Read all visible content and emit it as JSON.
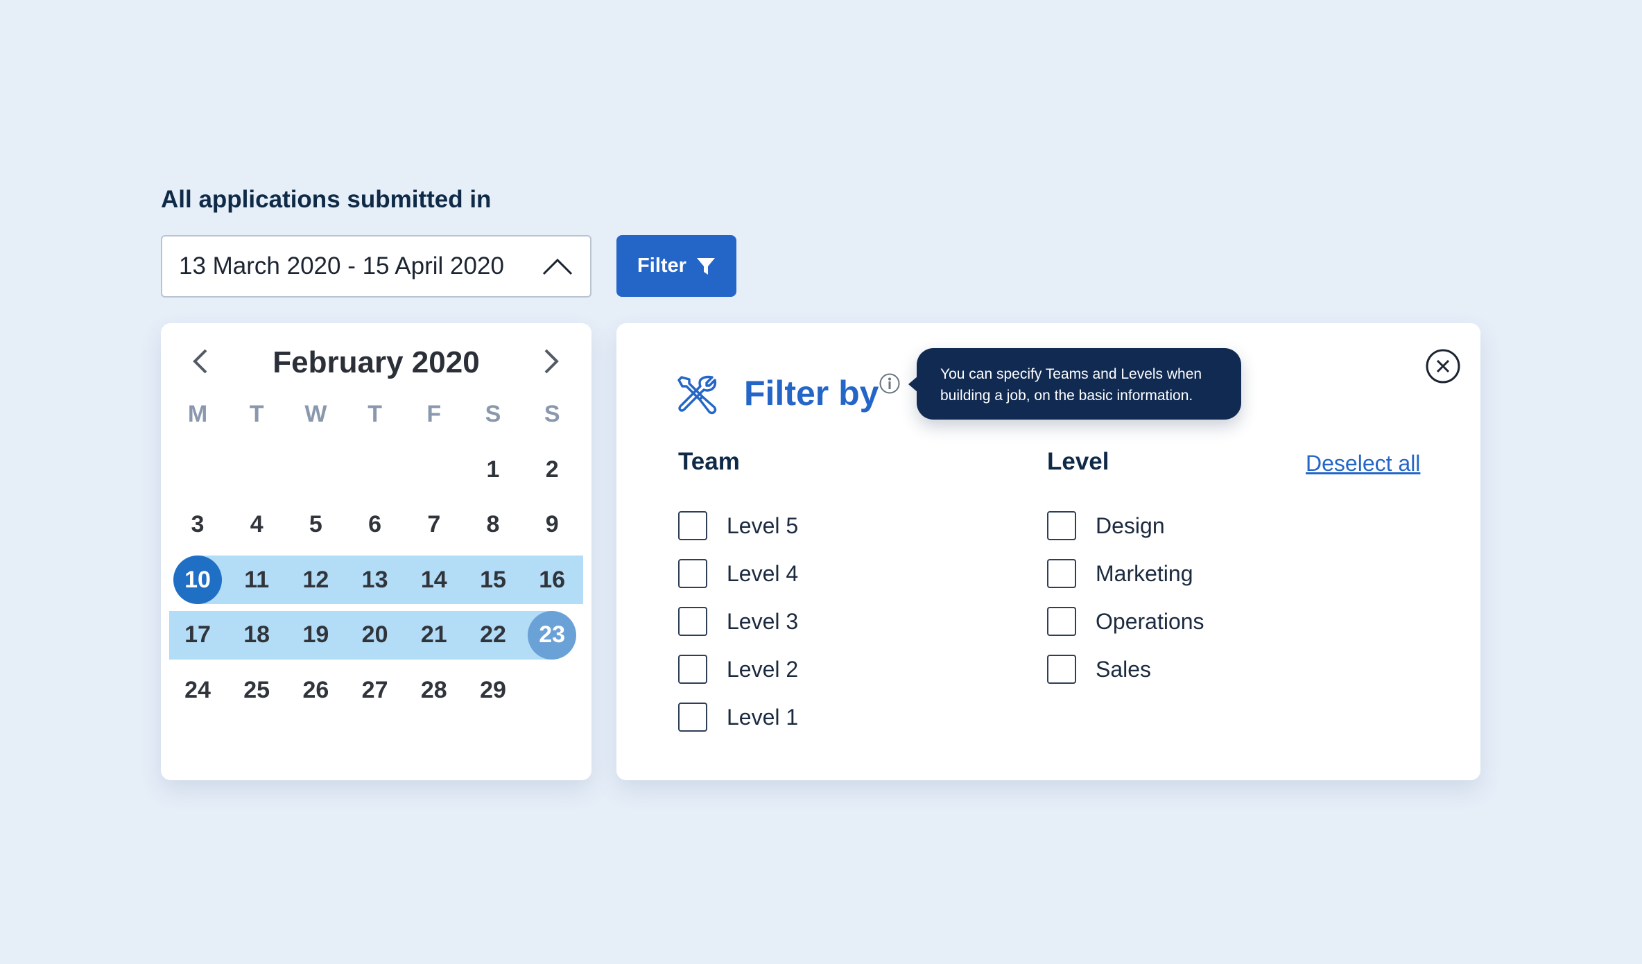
{
  "header": {
    "title": "All applications submitted in",
    "date_range": "13 March 2020 - 15 April 2020",
    "filter_label": "Filter"
  },
  "calendar": {
    "month": "February 2020",
    "weekdays": [
      "M",
      "T",
      "W",
      "T",
      "F",
      "S",
      "S"
    ],
    "leading_blanks": 5,
    "days": [
      "1",
      "2",
      "3",
      "4",
      "5",
      "6",
      "7",
      "8",
      "9",
      "10",
      "11",
      "12",
      "13",
      "14",
      "15",
      "16",
      "17",
      "18",
      "19",
      "20",
      "21",
      "22",
      "23",
      "24",
      "25",
      "26",
      "27",
      "28",
      "29"
    ],
    "range_start": "10",
    "range_end": "23",
    "colors": {
      "range": "#b3dcf7",
      "start": "#1f6fc5",
      "end": "#6aa1d6"
    }
  },
  "filter_panel": {
    "title": "Filter by",
    "tooltip": "You can specify Teams and Levels when building a job, on the basic information.",
    "team_title": "Team",
    "level_title": "Level",
    "deselect_label": "Deselect all",
    "team_options": [
      "Level 5",
      "Level 4",
      "Level 3",
      "Level 2",
      "Level 1"
    ],
    "level_options": [
      "Design",
      "Marketing",
      "Operations",
      "Sales"
    ]
  },
  "icons": {
    "date_toggle": "chevron-up-icon",
    "filter": "funnel-icon",
    "prev": "chevron-left-icon",
    "next": "chevron-right-icon",
    "tools": "tools-icon",
    "info": "info-icon",
    "close": "close-circle-icon"
  },
  "colors": {
    "accent": "#2466c8",
    "tooltip_bg": "#102a52",
    "background": "#e6eef8"
  }
}
